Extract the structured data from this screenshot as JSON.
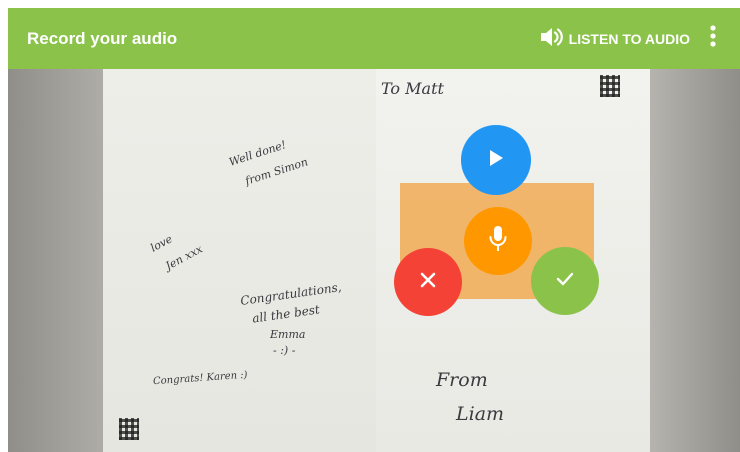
{
  "appbar": {
    "title": "Record your audio",
    "listen_label": "LISTEN TO AUDIO",
    "icons": {
      "listen": "volume-icon",
      "more": "more-vert-icon"
    },
    "color": "#8bc34a"
  },
  "card": {
    "left_notes": [
      "Well done!",
      "from Simon",
      "love",
      "Jen xxx",
      "Congratulations,",
      "all the best",
      "Emma",
      "- :) -",
      "Congrats! Karen :)"
    ],
    "right_notes": [
      "To Matt",
      "From",
      "Liam"
    ]
  },
  "controls": {
    "play": {
      "icon": "play-icon",
      "color": "#2196f3"
    },
    "record": {
      "icon": "microphone-icon",
      "color": "#ff9800"
    },
    "cancel": {
      "icon": "close-icon",
      "color": "#f44336"
    },
    "confirm": {
      "icon": "check-icon",
      "color": "#8bc34a"
    }
  }
}
